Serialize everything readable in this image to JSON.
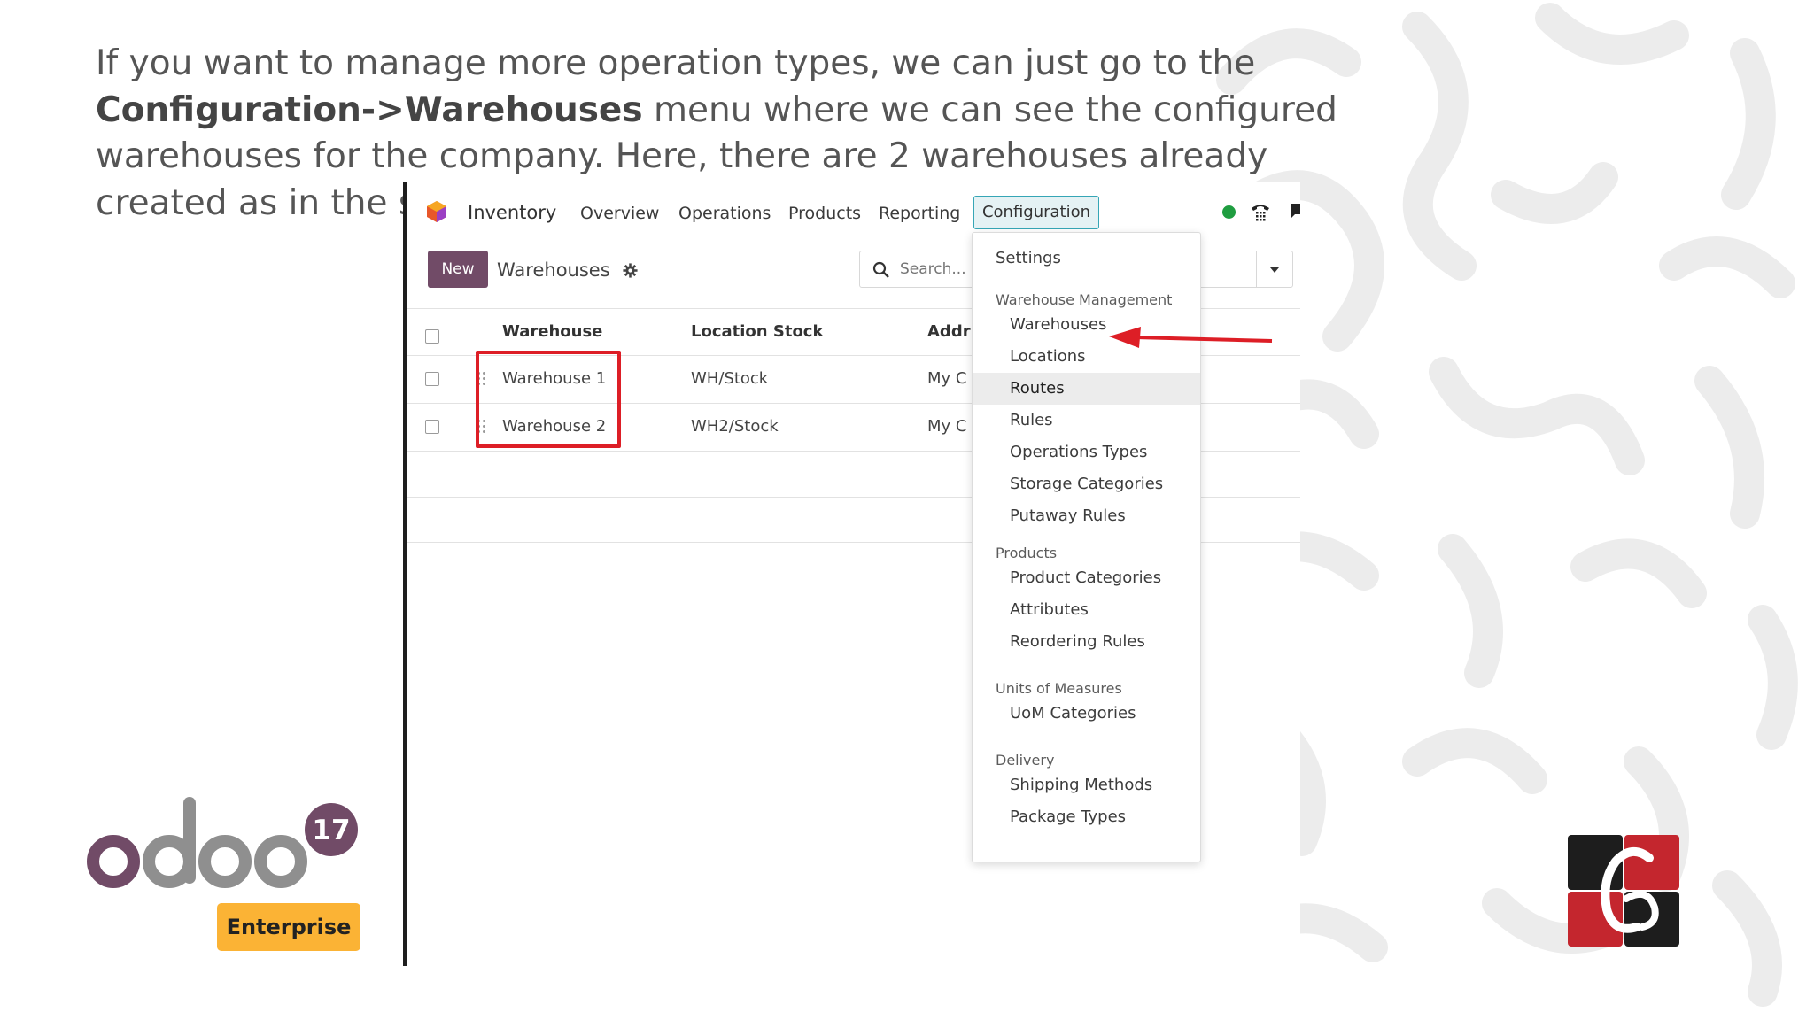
{
  "intro": {
    "part1": "If you want to manage more operation types, we can just go to the",
    "bold": "Configuration->Warehouses",
    "part2": "menu where we can see the configured warehouses for the company. Here, there are 2 warehouses already created as in the screenshot."
  },
  "app": {
    "name": "Inventory",
    "nav": [
      "Overview",
      "Operations",
      "Products",
      "Reporting",
      "Configuration"
    ]
  },
  "toolbar": {
    "new_label": "New",
    "view_title": "Warehouses",
    "search_placeholder": "Search..."
  },
  "table": {
    "columns": [
      "Warehouse",
      "Location Stock",
      "Addr"
    ],
    "rows": [
      {
        "warehouse": "Warehouse 1",
        "location_stock": "WH/Stock",
        "address": "My C"
      },
      {
        "warehouse": "Warehouse 2",
        "location_stock": "WH2/Stock",
        "address": "My C"
      }
    ]
  },
  "dropdown": {
    "settings": "Settings",
    "sections": [
      {
        "header": "Warehouse Management",
        "items": [
          "Warehouses",
          "Locations",
          "Routes",
          "Rules",
          "Operations Types",
          "Storage Categories",
          "Putaway Rules"
        ]
      },
      {
        "header": "Products",
        "items": [
          "Product Categories",
          "Attributes",
          "Reordering Rules"
        ]
      },
      {
        "header": "Units of Measures",
        "items": [
          "UoM Categories"
        ]
      },
      {
        "header": "Delivery",
        "items": [
          "Shipping Methods",
          "Package Types"
        ]
      }
    ],
    "hovered_item": "Routes"
  },
  "logo": {
    "version": "17",
    "edition": "Enterprise"
  },
  "colors": {
    "odoo_purple": "#714b67",
    "odoo_gray": "#8f8f8f",
    "badge_yellow": "#fbb335",
    "highlight_red": "#dd1e26",
    "status_green": "#1f9d40",
    "config_active_border": "#36a6b6"
  },
  "icons": {
    "app": "inventory-app-icon",
    "settings": "gear-icon",
    "search": "search-icon",
    "dropdown": "caret-down-icon",
    "status": "status-dot",
    "phone": "phone-icon",
    "chat": "chat-icon",
    "drag": "drag-handle-icon",
    "arrow": "red-arrow-icon"
  }
}
